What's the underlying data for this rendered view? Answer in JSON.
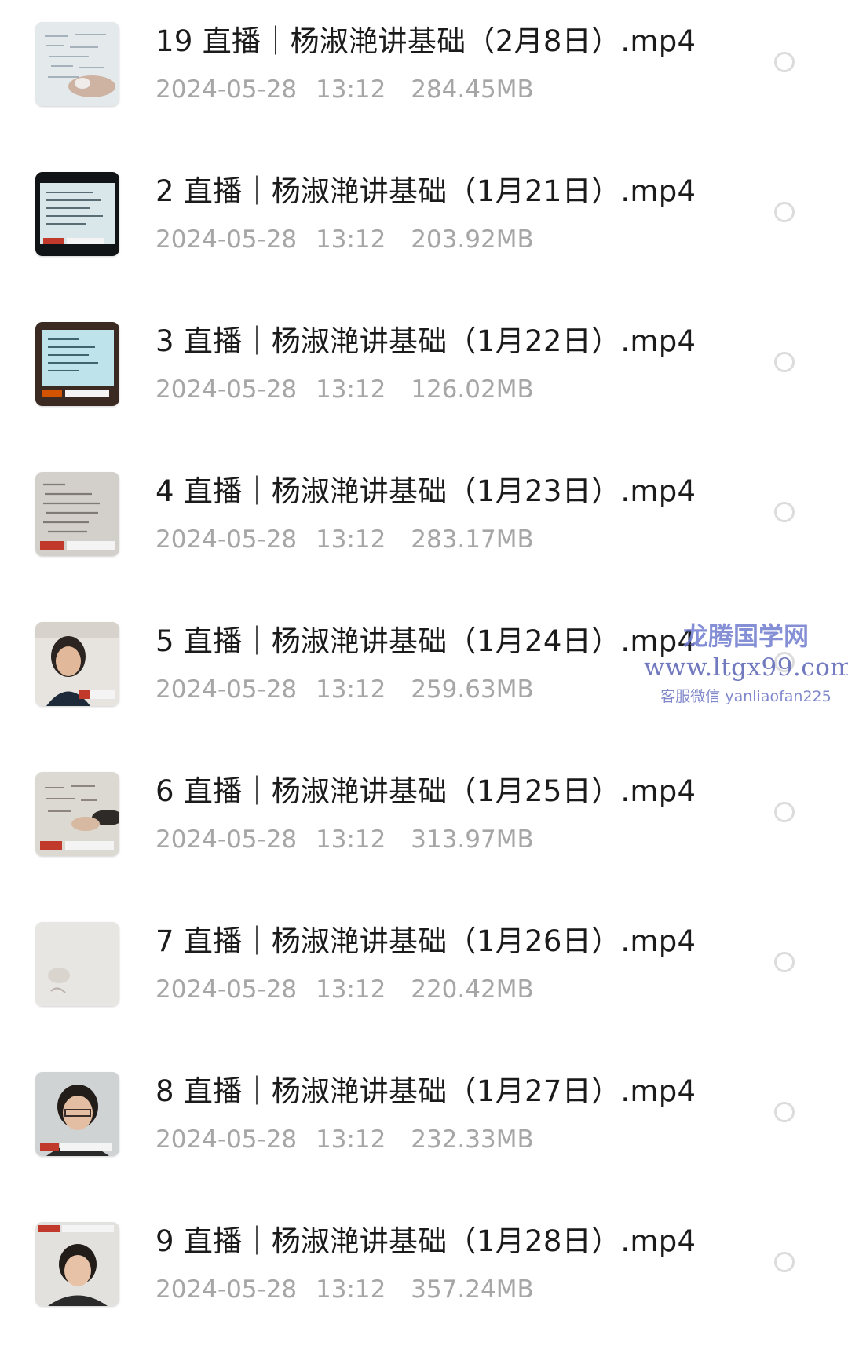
{
  "files": [
    {
      "name": "19 直播｜杨淑滟讲基础（2月8日）.mp4",
      "date": "2024-05-28",
      "time": "13:12",
      "size": "284.45MB",
      "thumb": "whiteboard"
    },
    {
      "name": "2 直播｜杨淑滟讲基础（1月21日）.mp4",
      "date": "2024-05-28",
      "time": "13:12",
      "size": "203.92MB",
      "thumb": "slide-dark"
    },
    {
      "name": "3 直播｜杨淑滟讲基础（1月22日）.mp4",
      "date": "2024-05-28",
      "time": "13:12",
      "size": "126.02MB",
      "thumb": "slide-screen"
    },
    {
      "name": "4 直播｜杨淑滟讲基础（1月23日）.mp4",
      "date": "2024-05-28",
      "time": "13:12",
      "size": "283.17MB",
      "thumb": "handwriting"
    },
    {
      "name": "5 直播｜杨淑滟讲基础（1月24日）.mp4",
      "date": "2024-05-28",
      "time": "13:12",
      "size": "259.63MB",
      "thumb": "presenter-bright"
    },
    {
      "name": "6 直播｜杨淑滟讲基础（1月25日）.mp4",
      "date": "2024-05-28",
      "time": "13:12",
      "size": "313.97MB",
      "thumb": "whiteboard-hand"
    },
    {
      "name": "7 直播｜杨淑滟讲基础（1月26日）.mp4",
      "date": "2024-05-28",
      "time": "13:12",
      "size": "220.42MB",
      "thumb": "blank-board"
    },
    {
      "name": "8 直播｜杨淑滟讲基础（1月27日）.mp4",
      "date": "2024-05-28",
      "time": "13:12",
      "size": "232.33MB",
      "thumb": "presenter"
    },
    {
      "name": "9 直播｜杨淑滟讲基础（1月28日）.mp4",
      "date": "2024-05-28",
      "time": "13:12",
      "size": "357.24MB",
      "thumb": "presenter-top"
    }
  ],
  "watermark": {
    "name": "龙腾国学网",
    "url": "www.ltgx99.com",
    "wechat": "客服微信 yanliaofan225"
  },
  "colors": {
    "title": "#1b1b1b",
    "meta": "#a6a6a6",
    "select_border": "#dcdcdc",
    "watermark": "#5b67b8"
  }
}
